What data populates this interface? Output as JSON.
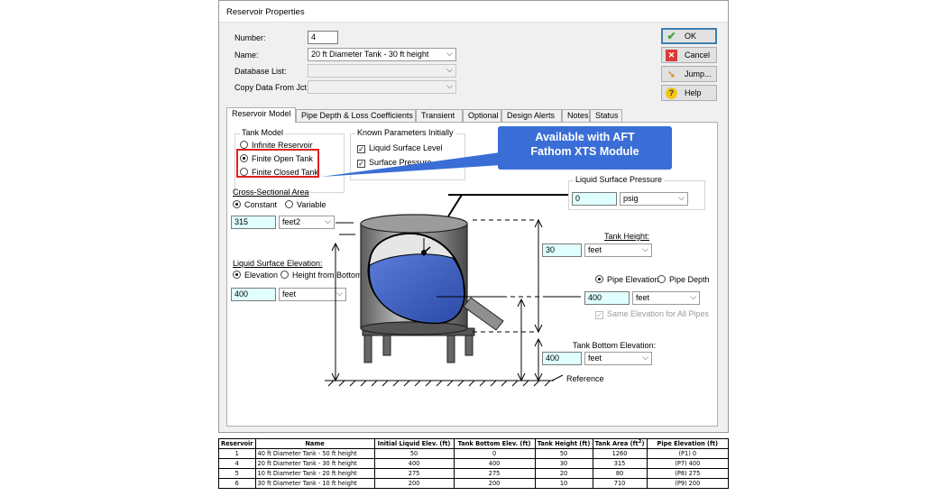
{
  "dialog": {
    "title": "Reservoir Properties",
    "number_label": "Number:",
    "number_value": "4",
    "name_label": "Name:",
    "name_value": "20 ft Diameter Tank - 30 ft height",
    "database_label": "Database List:",
    "database_value": "",
    "copy_label": "Copy Data From Jct...",
    "copy_value": ""
  },
  "buttons": {
    "ok": "OK",
    "cancel": "Cancel",
    "jump": "Jump...",
    "help": "Help"
  },
  "tabs": [
    "Reservoir Model",
    "Pipe Depth & Loss Coefficients",
    "Transient",
    "Optional",
    "Design Alerts",
    "Notes",
    "Status"
  ],
  "tank_model": {
    "title": "Tank Model",
    "options": [
      "Infinite Reservoir",
      "Finite Open Tank",
      "Finite Closed Tank"
    ],
    "selected": "Finite Open Tank"
  },
  "known_params": {
    "title": "Known Parameters Initially",
    "options": [
      "Liquid Surface Level",
      "Surface Pressure"
    ]
  },
  "callout": {
    "line1": "Available with AFT",
    "line2": "Fathom XTS Module"
  },
  "cross_section": {
    "title": "Cross-Sectional Area",
    "constant": "Constant",
    "variable": "Variable",
    "value": "315",
    "unit": "feet2"
  },
  "liquid_elev": {
    "title": "Liquid Surface Elevation:",
    "elevation": "Elevation",
    "height_from_bottom": "Height from Bottom",
    "value": "400",
    "unit": "feet"
  },
  "surface_pressure": {
    "title": "Liquid Surface Pressure",
    "value": "0",
    "unit": "psig"
  },
  "tank_height": {
    "title": "Tank Height:",
    "value": "30",
    "unit": "feet"
  },
  "pipe": {
    "pipe_elevation": "Pipe Elevation",
    "pipe_depth": "Pipe Depth",
    "value": "400",
    "unit": "feet",
    "same_elev": "Same Elevation for All Pipes"
  },
  "tank_bottom": {
    "title": "Tank Bottom Elevation:",
    "value": "400",
    "unit": "feet"
  },
  "reference_label": "Reference",
  "table": {
    "headers": [
      "Reservoir",
      "Name",
      "Initial Liquid Elev. (ft)",
      "Tank Bottom Elev. (ft)",
      "Tank Height (ft)",
      "Tank Area (ft",
      "Pipe Elevation (ft)"
    ],
    "area_sup": "2",
    "area_close": ")",
    "rows": [
      [
        "1",
        "40 ft Diameter Tank - 50 ft height",
        "50",
        "0",
        "50",
        "1260",
        "(P1) 0"
      ],
      [
        "4",
        "20 ft Diameter Tank - 30 ft height",
        "400",
        "400",
        "30",
        "315",
        "(P7) 400"
      ],
      [
        "5",
        "10 ft Diameter Tank - 20 ft height",
        "275",
        "275",
        "20",
        "80",
        "(P8) 275"
      ],
      [
        "6",
        "30 ft Diameter Tank - 10 ft height",
        "200",
        "200",
        "10",
        "710",
        "(P9) 200"
      ]
    ]
  },
  "colors": {
    "callout": "#3a6ed6",
    "highlight": "#e02020",
    "input_bg": "#e0ffff",
    "tank_liquid": "#3f62c0"
  }
}
